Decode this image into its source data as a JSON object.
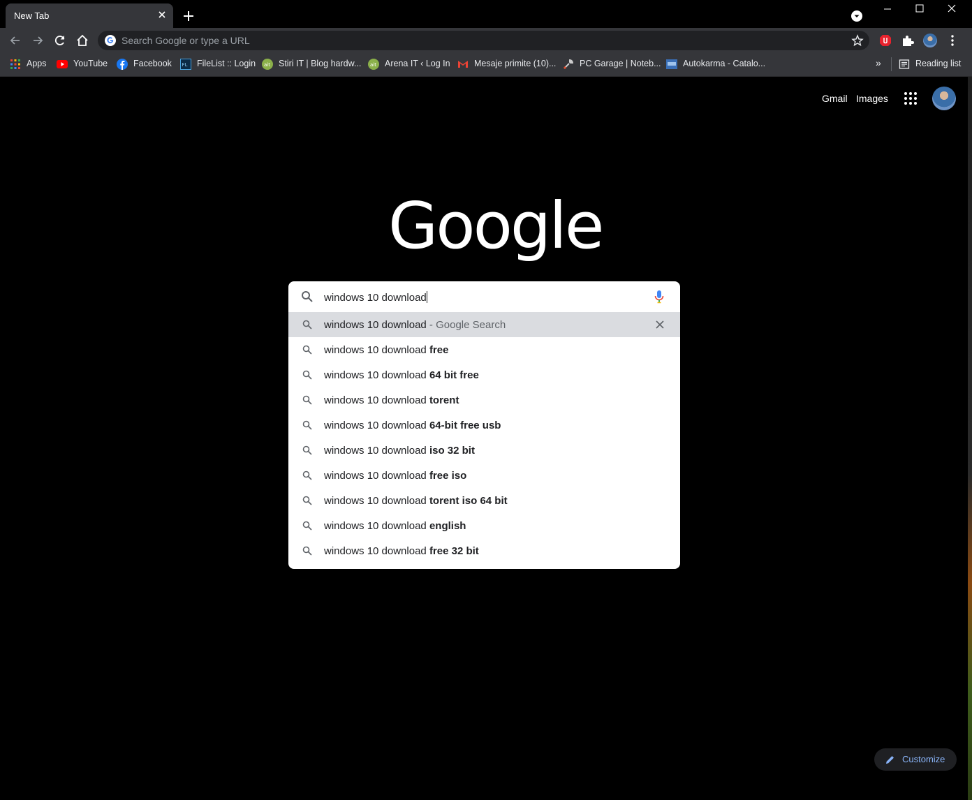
{
  "browser": {
    "tab_title": "New Tab",
    "omnibox_placeholder": "Search Google or type a URL",
    "bookmarks": [
      {
        "label": "Apps",
        "icon": "apps-grid-icon"
      },
      {
        "label": "YouTube",
        "icon": "youtube-icon"
      },
      {
        "label": "Facebook",
        "icon": "facebook-icon"
      },
      {
        "label": "FileList :: Login",
        "icon": "filelist-icon"
      },
      {
        "label": "Stiri IT | Blog hardw...",
        "icon": "ait-icon"
      },
      {
        "label": "Arena IT ‹ Log In",
        "icon": "ait-icon"
      },
      {
        "label": "Mesaje primite (10)...",
        "icon": "gmail-icon"
      },
      {
        "label": "PC Garage | Noteb...",
        "icon": "wrench-icon"
      },
      {
        "label": "Autokarma - Catalo...",
        "icon": "autokarma-icon"
      }
    ],
    "bookmarks_overflow": "»",
    "reading_list": "Reading list"
  },
  "page": {
    "gmail": "Gmail",
    "images": "Images",
    "logo": "Google",
    "search": {
      "query": "windows 10 download",
      "suggestions": [
        {
          "prefix": "windows 10 download",
          "suffix": " - Google Search",
          "bold": false,
          "selected": true
        },
        {
          "prefix": "windows 10 download",
          "suffix": "free",
          "bold": true
        },
        {
          "prefix": "windows 10 download",
          "suffix": "64 bit free",
          "bold": true
        },
        {
          "prefix": "windows 10 download",
          "suffix": "torent",
          "bold": true
        },
        {
          "prefix": "windows 10 download",
          "suffix": "64-bit free usb",
          "bold": true
        },
        {
          "prefix": "windows 10 download",
          "suffix": "iso 32 bit",
          "bold": true
        },
        {
          "prefix": "windows 10 download",
          "suffix": "free iso",
          "bold": true
        },
        {
          "prefix": "windows 10 download",
          "suffix": "torent iso 64 bit",
          "bold": true
        },
        {
          "prefix": "windows 10 download",
          "suffix": "english",
          "bold": true
        },
        {
          "prefix": "windows 10 download",
          "suffix": "free 32 bit",
          "bold": true
        }
      ]
    },
    "customize": "Customize"
  },
  "colors": {
    "background": "#000000",
    "toolbar": "#35363a",
    "link_blue": "#8ab4f8",
    "selected_row": "#dadce0"
  }
}
